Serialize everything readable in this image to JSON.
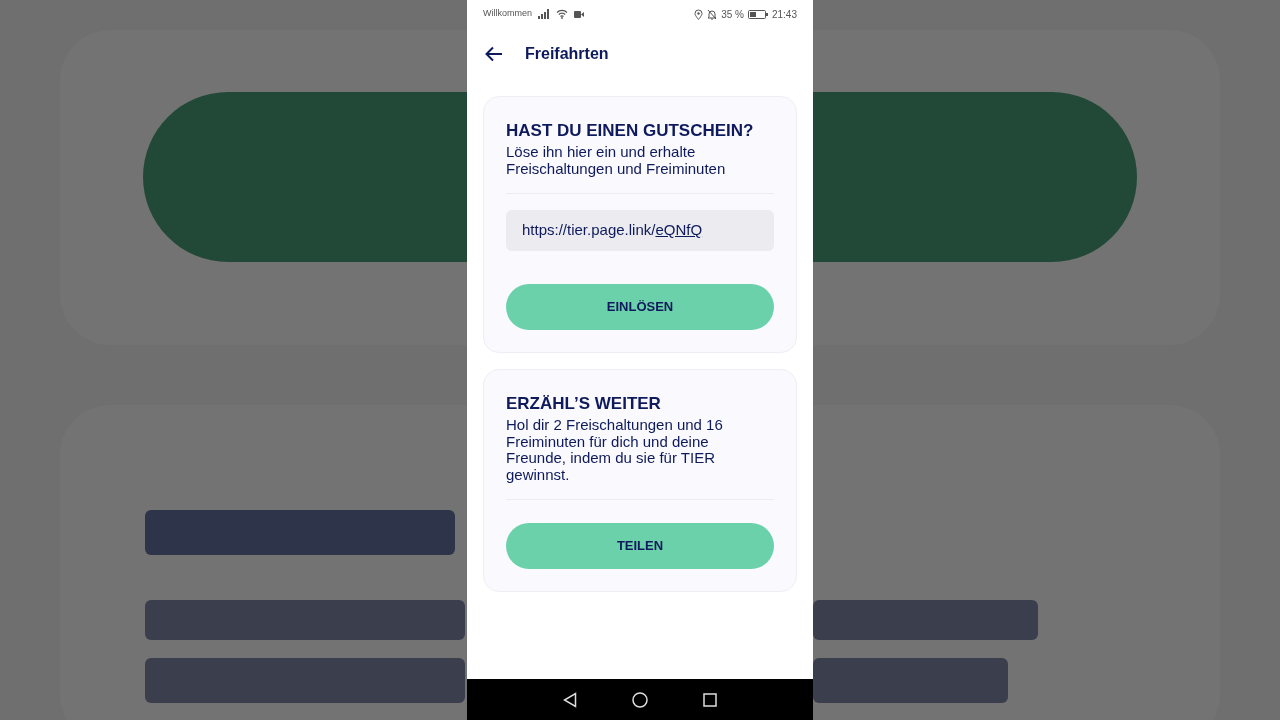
{
  "status_bar": {
    "carrier": "Willkommen",
    "battery": "35 %",
    "time": "21:43"
  },
  "header": {
    "title": "Freifahrten"
  },
  "voucher_card": {
    "title": "HAST DU EINEN GUTSCHEIN?",
    "text": "Löse ihn hier ein und erhalte Freischaltungen und Freiminuten",
    "link_prefix": "https://tier.page.link/",
    "link_code": "eQNfQ",
    "button": "EINLÖSEN"
  },
  "share_card": {
    "title": "ERZÄHL’S WEITER",
    "text": "Hol dir 2 Freischaltungen und 16 Freiminuten für dich und deine Freunde, indem du sie für TIER gewinnst.",
    "button": "TEILEN"
  }
}
